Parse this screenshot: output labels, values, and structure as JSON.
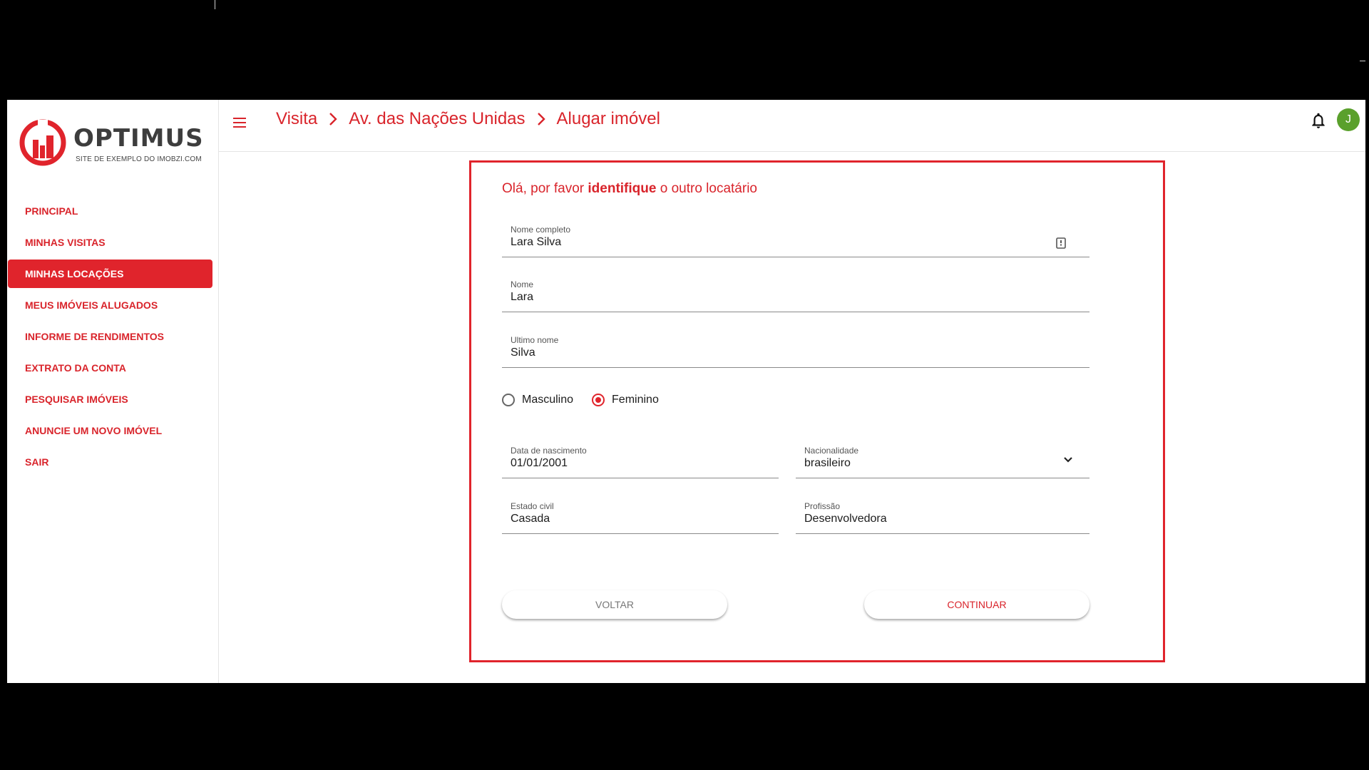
{
  "brand": {
    "name": "OPTIMUS",
    "tagline": "SITE DE EXEMPLO DO IMOBZI.COM",
    "accent_color": "#e0242c"
  },
  "sidebar": {
    "items": [
      {
        "label": "PRINCIPAL",
        "active": false
      },
      {
        "label": "MINHAS VISITAS",
        "active": false
      },
      {
        "label": "MINHAS LOCAÇÕES",
        "active": true
      },
      {
        "label": "MEUS IMÓVEIS ALUGADOS",
        "active": false
      },
      {
        "label": "INFORME DE RENDIMENTOS",
        "active": false
      },
      {
        "label": "EXTRATO DA CONTA",
        "active": false
      },
      {
        "label": "PESQUISAR IMÓVEIS",
        "active": false
      },
      {
        "label": "ANUNCIE UM NOVO IMÓVEL",
        "active": false
      },
      {
        "label": "SAIR",
        "active": false
      }
    ]
  },
  "header": {
    "breadcrumb": [
      "Visita",
      "Av. das Nações Unidas",
      "Alugar imóvel"
    ],
    "avatar_initial": "J",
    "icons": [
      "menu-icon",
      "chevron-right-icon",
      "bell-icon"
    ]
  },
  "form": {
    "greeting_prefix": "Olá, por favor",
    "greeting_bold": "identifique",
    "greeting_suffix": "o outro locatário",
    "fields": {
      "full_name": {
        "label": "Nome completo",
        "value": "Lara Silva",
        "icon": "contact-card-icon"
      },
      "first_name": {
        "label": "Nome",
        "value": "Lara"
      },
      "last_name": {
        "label": "Ultimo nome",
        "value": "Silva"
      },
      "birth_date": {
        "label": "Data de nascimento",
        "value": "01/01/2001"
      },
      "nationality": {
        "label": "Nacionalidade",
        "value": "brasileiro",
        "icon": "chevron-down-icon"
      },
      "marital_status": {
        "label": "Estado civil",
        "value": "Casada"
      },
      "profession": {
        "label": "Profissão",
        "value": "Desenvolvedora"
      }
    },
    "gender": {
      "options": [
        "Masculino",
        "Feminino"
      ],
      "selected": "Feminino"
    },
    "back_label": "VOLTAR",
    "continue_label": "CONTINUAR"
  }
}
